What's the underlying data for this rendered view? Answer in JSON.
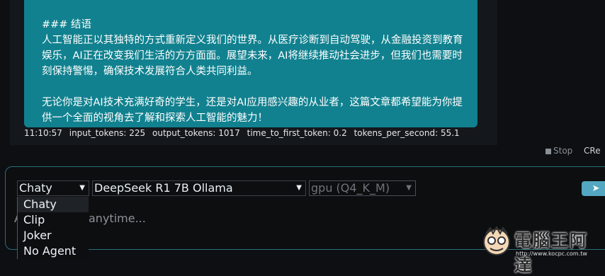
{
  "message": {
    "heading": "### 结语",
    "para1": "人工智能正以其独特的方式重新定义我们的世界。从医疗诊断到自动驾驶，从金融投资到教育娱乐，AI正在改变我们生活的方方面面。展望未来，AI将继续推动社会进步，但我们也需要时刻保持警惕，确保技术发展符合人类共同利益。",
    "para2": "无论你是对AI技术充满好奇的学生，还是对AI应用感兴趣的从业者，这篇文章都希望能为你提供一个全面的视角去了解和探索人工智能的魅力！"
  },
  "stats": {
    "time": "11:10:57",
    "input_tokens": "input_tokens: 225",
    "output_tokens": "output_tokens: 1017",
    "ttft": "time_to_first_token: 0.2",
    "tps": "tokens_per_second: 55.1"
  },
  "actions": {
    "stop": "Stop",
    "retry": "Re"
  },
  "composer": {
    "agent_selected": "Chaty",
    "model_selected": "DeepSeek R1 7B Ollama",
    "gpu_selected": "gpu (Q4_K_M)",
    "placeholder_partial": "anytime...",
    "placeholder_prefix": "A",
    "agent_options": [
      "Chaty",
      "Clip",
      "Joker",
      "No Agent"
    ]
  },
  "watermark": {
    "text": "電腦王阿達",
    "url": "http://www.kocpc.com.tw"
  },
  "icons": {
    "send": "send-icon",
    "stop": "stop-icon",
    "retry": "retry-icon",
    "dropdown": "chevron-down-icon"
  },
  "colors": {
    "bubble": "#11818f",
    "accent": "#54a7c1",
    "border": "#2b6f7b"
  }
}
